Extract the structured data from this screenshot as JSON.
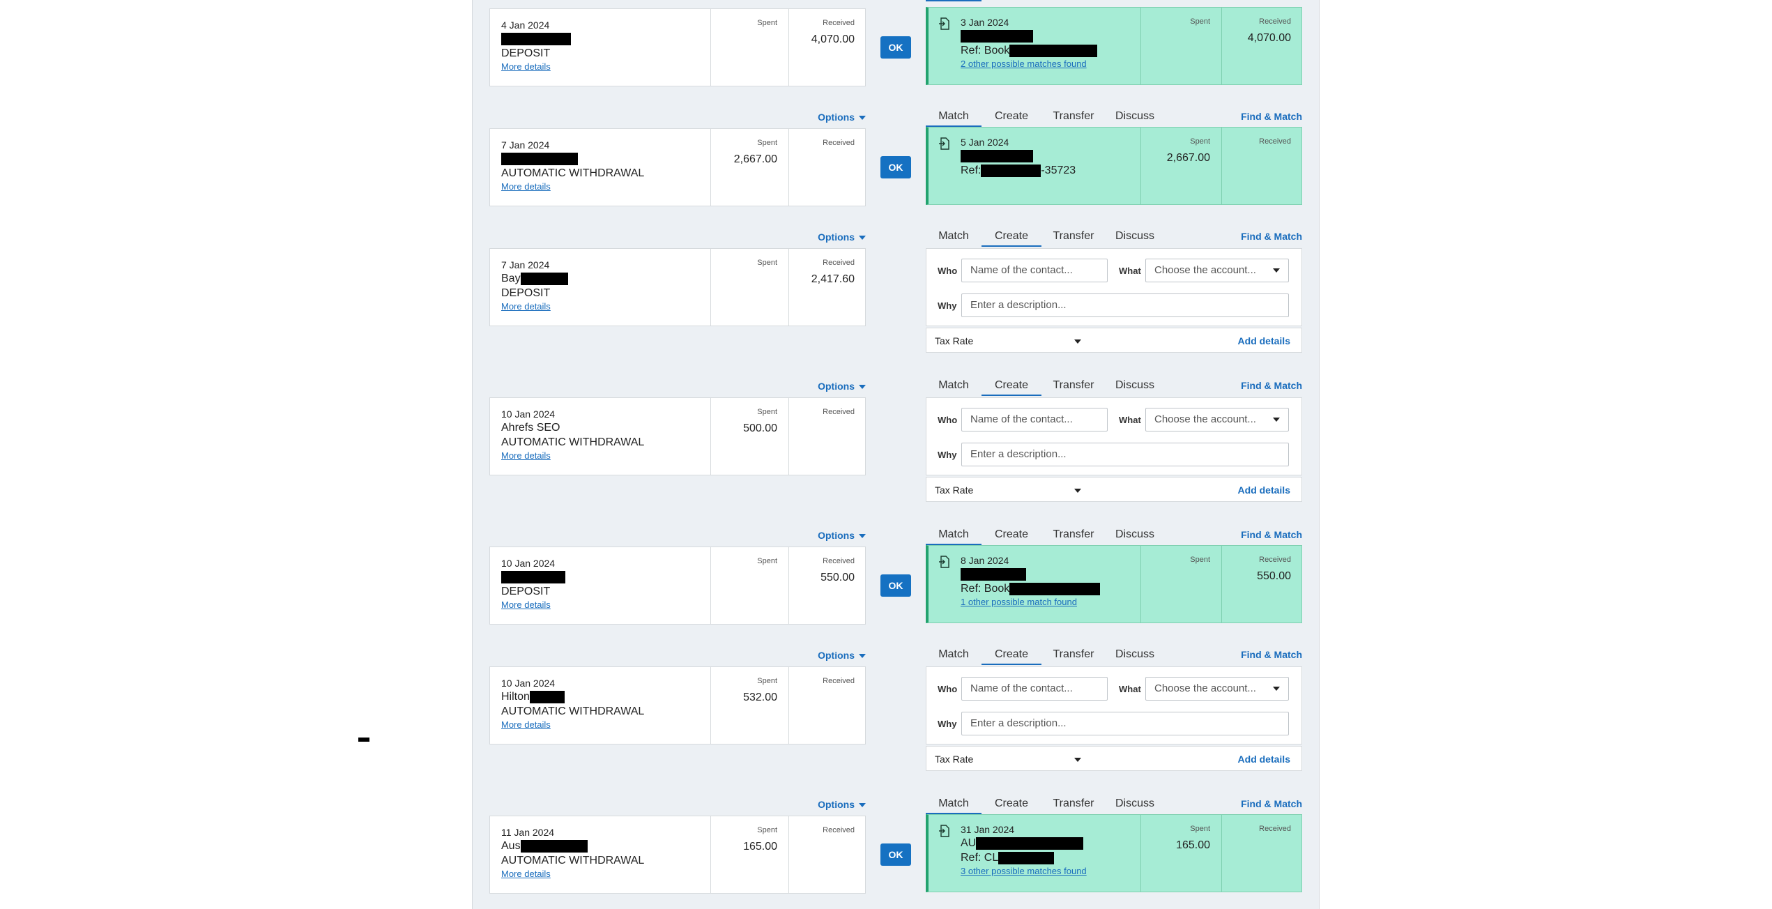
{
  "labels": {
    "spent": "Spent",
    "received": "Received",
    "ok": "OK",
    "options": "Options",
    "more_details": "More details",
    "find_match": "Find & Match",
    "who": "Who",
    "what": "What",
    "why": "Why",
    "tax_rate": "Tax Rate",
    "add_details": "Add details"
  },
  "tabs": [
    "Match",
    "Create",
    "Transfer",
    "Discuss"
  ],
  "create_form": {
    "who_placeholder": "Name of the contact...",
    "what_placeholder": "Choose the account...",
    "why_placeholder": "Enter a description..."
  },
  "rows": [
    {
      "statement": {
        "date": "4 Jan 2024",
        "name_prefix": "",
        "type": "DEPOSIT",
        "spent": "",
        "received": "4,070.00"
      },
      "mode": "match",
      "active_tab": "Match",
      "match": {
        "date": "3 Jan 2024",
        "ref_prefix": "Ref: Book",
        "other": "2 other possible matches found",
        "spent": "",
        "received": "4,070.00"
      }
    },
    {
      "statement": {
        "date": "7 Jan 2024",
        "name_prefix": "",
        "type": "AUTOMATIC WITHDRAWAL",
        "spent": "2,667.00",
        "received": ""
      },
      "mode": "match",
      "active_tab": "Match",
      "match": {
        "date": "5 Jan 2024",
        "ref_prefix": "Ref:",
        "ref_suffix": "-35723",
        "other": "",
        "spent": "2,667.00",
        "received": ""
      }
    },
    {
      "statement": {
        "date": "7 Jan 2024",
        "name_prefix": "Bay",
        "type": "DEPOSIT",
        "spent": "",
        "received": "2,417.60"
      },
      "mode": "create",
      "active_tab": "Create"
    },
    {
      "statement": {
        "date": "10 Jan 2024",
        "name_prefix": "Ahrefs SEO",
        "type": "AUTOMATIC WITHDRAWAL",
        "spent": "500.00",
        "received": ""
      },
      "mode": "create",
      "active_tab": "Create"
    },
    {
      "statement": {
        "date": "10 Jan 2024",
        "name_prefix": "",
        "type": "DEPOSIT",
        "spent": "",
        "received": "550.00"
      },
      "mode": "match",
      "active_tab": "Match",
      "match": {
        "date": "8 Jan 2024",
        "ref_prefix": "Ref: Book",
        "other": "1 other possible match found",
        "spent": "",
        "received": "550.00"
      }
    },
    {
      "statement": {
        "date": "10 Jan 2024",
        "name_prefix": "Hilton",
        "type": "AUTOMATIC WITHDRAWAL",
        "spent": "532.00",
        "received": ""
      },
      "mode": "create",
      "active_tab": "Create"
    },
    {
      "statement": {
        "date": "11 Jan 2024",
        "name_prefix": "Aus",
        "type": "AUTOMATIC WITHDRAWAL",
        "spent": "165.00",
        "received": ""
      },
      "mode": "match",
      "active_tab": "Match",
      "match": {
        "date": "31 Jan 2024",
        "name_prefix": "AU",
        "ref_prefix": "Ref: CL",
        "other": "3 other possible matches found",
        "spent": "165.00",
        "received": ""
      }
    }
  ]
}
